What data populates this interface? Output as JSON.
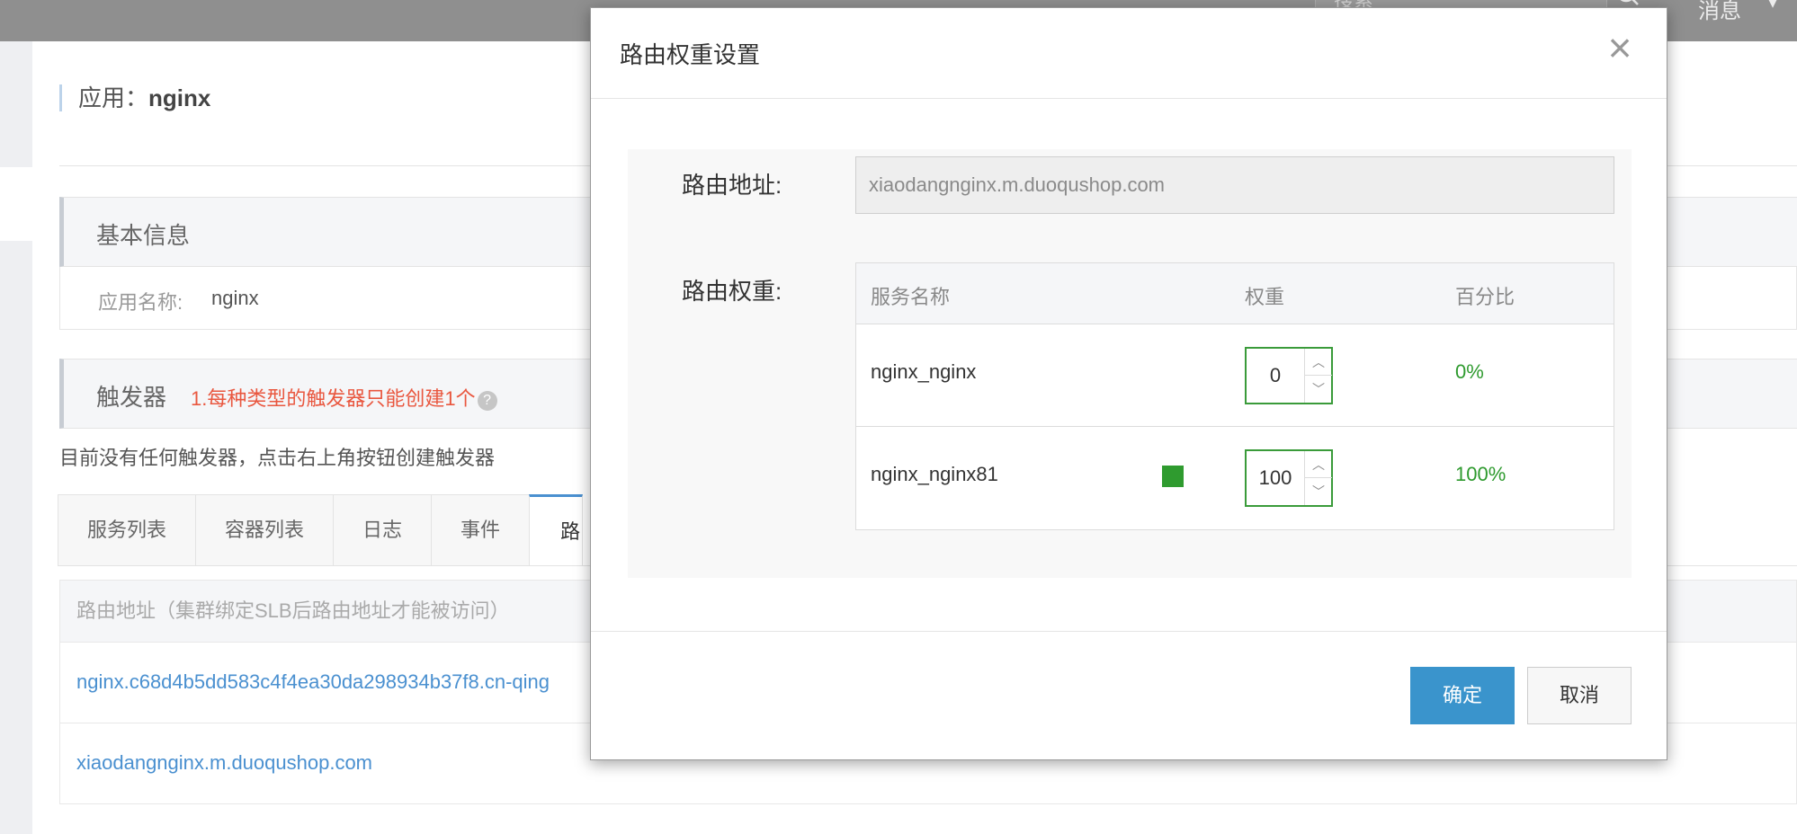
{
  "topbar": {
    "search_placeholder": "搜索",
    "messages_label": "消息",
    "arrow_glyph": "▾"
  },
  "app": {
    "title_prefix": "应用：",
    "title_name": "nginx"
  },
  "basic_info": {
    "title": "基本信息",
    "app_name_label": "应用名称:",
    "app_name_value": "nginx"
  },
  "triggers": {
    "title": "触发器",
    "warning": "1.每种类型的触发器只能创建1个",
    "help_glyph": "?",
    "empty_message": "目前没有任何触发器，点击右上角按钮创建触发器"
  },
  "tabs": [
    {
      "label": "服务列表"
    },
    {
      "label": "容器列表"
    },
    {
      "label": "日志"
    },
    {
      "label": "事件"
    },
    {
      "label": "路"
    }
  ],
  "routes": {
    "header": "路由地址（集群绑定SLB后路由地址才能被访问）",
    "rows": [
      {
        "url": "nginx.c68d4b5dd583c4f4ea30da298934b37f8.cn-qing"
      },
      {
        "url": "xiaodangnginx.m.duoqushop.com"
      }
    ]
  },
  "modal": {
    "title": "路由权重设置",
    "close_glyph": "×",
    "route_address_label": "路由地址:",
    "route_address_value": "xiaodangnginx.m.duoqushop.com",
    "route_weight_label": "路由权重:",
    "table_headers": {
      "service": "服务名称",
      "weight": "权重",
      "percent": "百分比"
    },
    "services": [
      {
        "name": "nginx_nginx",
        "weight": "0",
        "percent": "0%",
        "color_marker": false
      },
      {
        "name": "nginx_nginx81",
        "weight": "100",
        "percent": "100%",
        "color_marker": true
      }
    ],
    "spinner_up": "︿",
    "spinner_down": "﹀",
    "ok_label": "确定",
    "cancel_label": "取消"
  },
  "colors": {
    "primary": "#3a94cc",
    "success": "#2e9a2e",
    "warning": "#e9573f",
    "link": "#4a90d0"
  }
}
